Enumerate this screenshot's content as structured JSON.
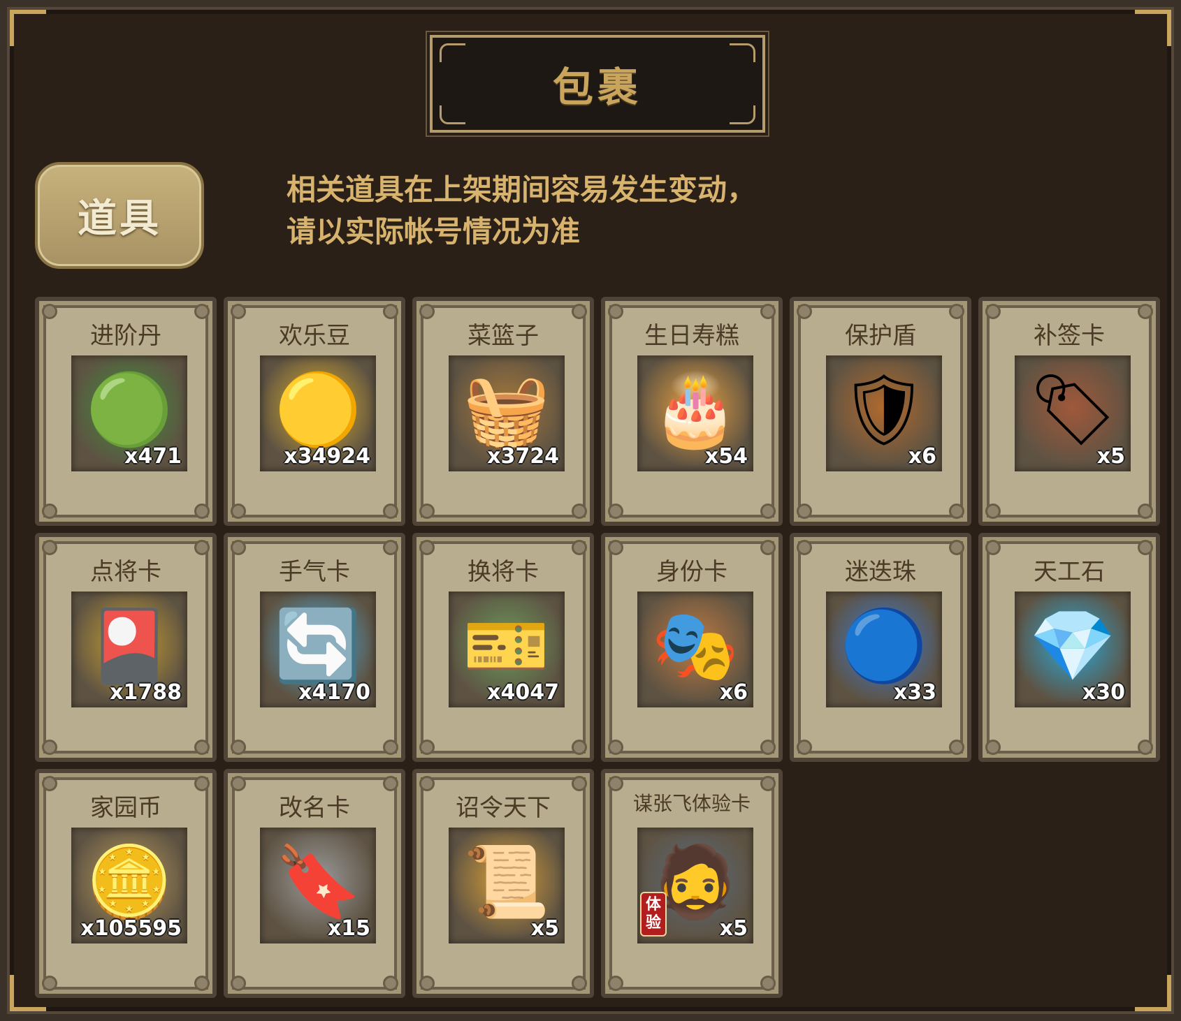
{
  "title": "包裹",
  "tab_label": "道具",
  "notice": {
    "line1": "相关道具在上架期间容易发生变动，",
    "line2": "请以实际帐号情况为准"
  },
  "items": [
    {
      "name": "进阶丹",
      "qty": "x471",
      "icon": "green-orb-icon",
      "glyph": "🟢",
      "color": "#3f8f3a"
    },
    {
      "name": "欢乐豆",
      "qty": "x34924",
      "icon": "golden-beans-icon",
      "glyph": "🟡",
      "color": "#e0b22a"
    },
    {
      "name": "菜篮子",
      "qty": "x3724",
      "icon": "flower-basket-icon",
      "glyph": "🧺",
      "color": "#a8793a"
    },
    {
      "name": "生日寿糕",
      "qty": "x54",
      "icon": "birthday-cake-icon",
      "glyph": "🎂",
      "color": "#e8a040"
    },
    {
      "name": "保护盾",
      "qty": "x6",
      "icon": "bronze-shield-icon",
      "glyph": "🛡",
      "color": "#b06a2e"
    },
    {
      "name": "补签卡",
      "qty": "x5",
      "icon": "signin-card-icon",
      "glyph": "🏷",
      "color": "#a0583a"
    },
    {
      "name": "点将卡",
      "qty": "x1788",
      "icon": "general-card-icon",
      "glyph": "🎴",
      "color": "#c8a030"
    },
    {
      "name": "手气卡",
      "qty": "x4170",
      "icon": "luck-card-icon",
      "glyph": "🔄",
      "color": "#4aa8d8"
    },
    {
      "name": "换将卡",
      "qty": "x4047",
      "icon": "swap-card-icon",
      "glyph": "🎫",
      "color": "#6a9a5a"
    },
    {
      "name": "身份卡",
      "qty": "x6",
      "icon": "identity-mask-icon",
      "glyph": "🎭",
      "color": "#c07a40"
    },
    {
      "name": "迷迭珠",
      "qty": "x33",
      "icon": "blue-pearl-icon",
      "glyph": "🔵",
      "color": "#3a7ad8"
    },
    {
      "name": "天工石",
      "qty": "x30",
      "icon": "crystal-stone-icon",
      "glyph": "💎",
      "color": "#2aa8d8"
    },
    {
      "name": "家园币",
      "qty": "x105595",
      "icon": "home-coin-icon",
      "glyph": "🪙",
      "color": "#b89a5a"
    },
    {
      "name": "改名卡",
      "qty": "x15",
      "icon": "rename-tag-icon",
      "glyph": "🔖",
      "color": "#9a9a9a"
    },
    {
      "name": "诏令天下",
      "qty": "x5",
      "icon": "edict-scroll-icon",
      "glyph": "📜",
      "color": "#d8a03a"
    },
    {
      "name": "谋张飞体验卡",
      "qty": "x5",
      "icon": "zhangfei-portrait-icon",
      "glyph": "🧔",
      "color": "#5a6a7a",
      "badge": "体验"
    }
  ]
}
